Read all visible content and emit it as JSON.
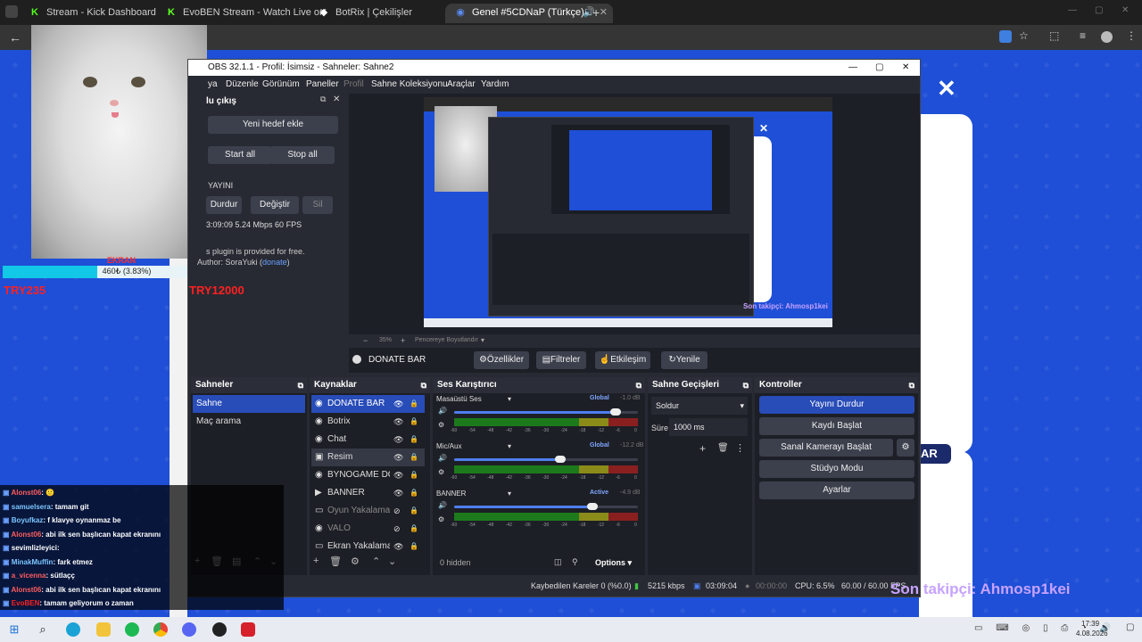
{
  "browser": {
    "tabs": [
      {
        "label": "Stream - Kick Dashboard",
        "icon": "kick-icon"
      },
      {
        "label": "EvoBEN Stream - Watch Live on",
        "icon": "kick-icon"
      },
      {
        "label": "BotRix | Çekilişler",
        "icon": "botrix-icon"
      },
      {
        "label": "Genel #5CDNaP (Türkçe) -",
        "icon": "discord-icon"
      }
    ]
  },
  "overlay": {
    "progress_text": "460₺ (3.83%)",
    "progress_fraction": 0.0383,
    "goal_label": "EKRAN",
    "amount_left": "TRY235",
    "amount_right": "TRY12000",
    "follower": "Son takipçi: Ahmosp1kei"
  },
  "obs": {
    "title": "OBS 32.1.1 - Profil: İsimsiz - Sahneler: Sahne2",
    "menu": [
      "ya",
      "Düzenle",
      "Görünüm",
      "Paneller",
      "Profil",
      "Sahne Koleksiyonu",
      "Araçlar",
      "Yardım"
    ],
    "multistream": {
      "title": "lu çıkış",
      "new_target": "Yeni hedef ekle",
      "start_all": "Start all",
      "stop_all": "Stop all",
      "stream_label": "YAYINI",
      "stop": "Durdur",
      "change": "Değiştir",
      "delete": "Sil",
      "stats": "3:09:09 5.24 Mbps 60 FPS",
      "plugin_line1": "s plugin is provided for free.",
      "plugin_line2": "Author: SoraYuki (",
      "plugin_link": "donate",
      "plugin_close": ")"
    },
    "preview": {
      "zoom": "35%",
      "fit_label": "Pencereye Boyutlandır",
      "inner_text": "Son takipçi: Ahmosp1kei"
    },
    "source_toolbar": {
      "selected": "DONATE BAR",
      "properties": "Özellikler",
      "filters": "Filtreler",
      "interact": "Etkileşim",
      "refresh": "Yenile"
    },
    "scenes": {
      "title": "Sahneler",
      "items": [
        "Sahne",
        "Maç arama"
      ]
    },
    "sources": {
      "title": "Kaynaklar",
      "items": [
        "DONATE BAR",
        "Botrix",
        "Chat",
        "Resim",
        "BYNOGAME DON",
        "BANNER",
        "Oyun Yakalama",
        "VALO",
        "Ekran Yakalama"
      ]
    },
    "mixer": {
      "title": "Ses Karıştırıcı",
      "channels": [
        {
          "name": "Masaüstü Ses",
          "badge": "Global",
          "db": "-1.0 dB",
          "level": 0.88
        },
        {
          "name": "Mic/Aux",
          "badge": "Global",
          "db": "-12.2 dB",
          "level": 0.58
        },
        {
          "name": "BANNER",
          "badge": "Active",
          "db": "-4.9 dB",
          "level": 0.75
        }
      ],
      "ticks": [
        "-60",
        "-54",
        "-48",
        "-42",
        "-36",
        "-30",
        "-24",
        "-18",
        "-12",
        "-6",
        "0"
      ],
      "hidden": "0 hidden",
      "options": "Options"
    },
    "transitions": {
      "title": "Sahne Geçişleri",
      "type": "Soldur",
      "duration_label": "Süre",
      "duration": "1000 ms"
    },
    "controls": {
      "title": "Kontroller",
      "stop_stream": "Yayını Durdur",
      "start_record": "Kaydı Başlat",
      "virtual_cam": "Sanal Kamerayı Başlat",
      "studio": "Stüdyo Modu",
      "settings": "Ayarlar"
    },
    "status": {
      "dropped": "Kaybedilen Kareler 0 (%0.0)",
      "bitrate": "5215 kbps",
      "time1": "03:09:04",
      "time2": "00:00:00",
      "cpu": "CPU: 6.5%",
      "fps": "60.00 / 60.00 FPS"
    }
  },
  "chat": [
    {
      "user": "Alonst06",
      "msg": ": 🙂"
    },
    {
      "user": "samuelsera",
      "msg": ": tamam git"
    },
    {
      "user": "Boyufkaz",
      "msg": ": f klavye oynanmaz be"
    },
    {
      "user": "Alonst06",
      "msg": ": abi ilk sen başlıcan kapat ekranını"
    },
    {
      "user": "sevimlizleyici",
      "msg": ":"
    },
    {
      "user": "MinakMuffin",
      "msg": ": fark etmez"
    },
    {
      "user": "a_vicenna",
      "msg": ": sütlaçç"
    },
    {
      "user": "Alonst06",
      "msg": ": abi ilk sen başlıcan kapat ekranını"
    },
    {
      "user": "EvoBEN",
      "msg": ": tamam geliyorum o zaman"
    }
  ],
  "site": {
    "bar_label": "AR"
  },
  "taskbar": {
    "time": "17:39",
    "date": "4.08.2026"
  }
}
